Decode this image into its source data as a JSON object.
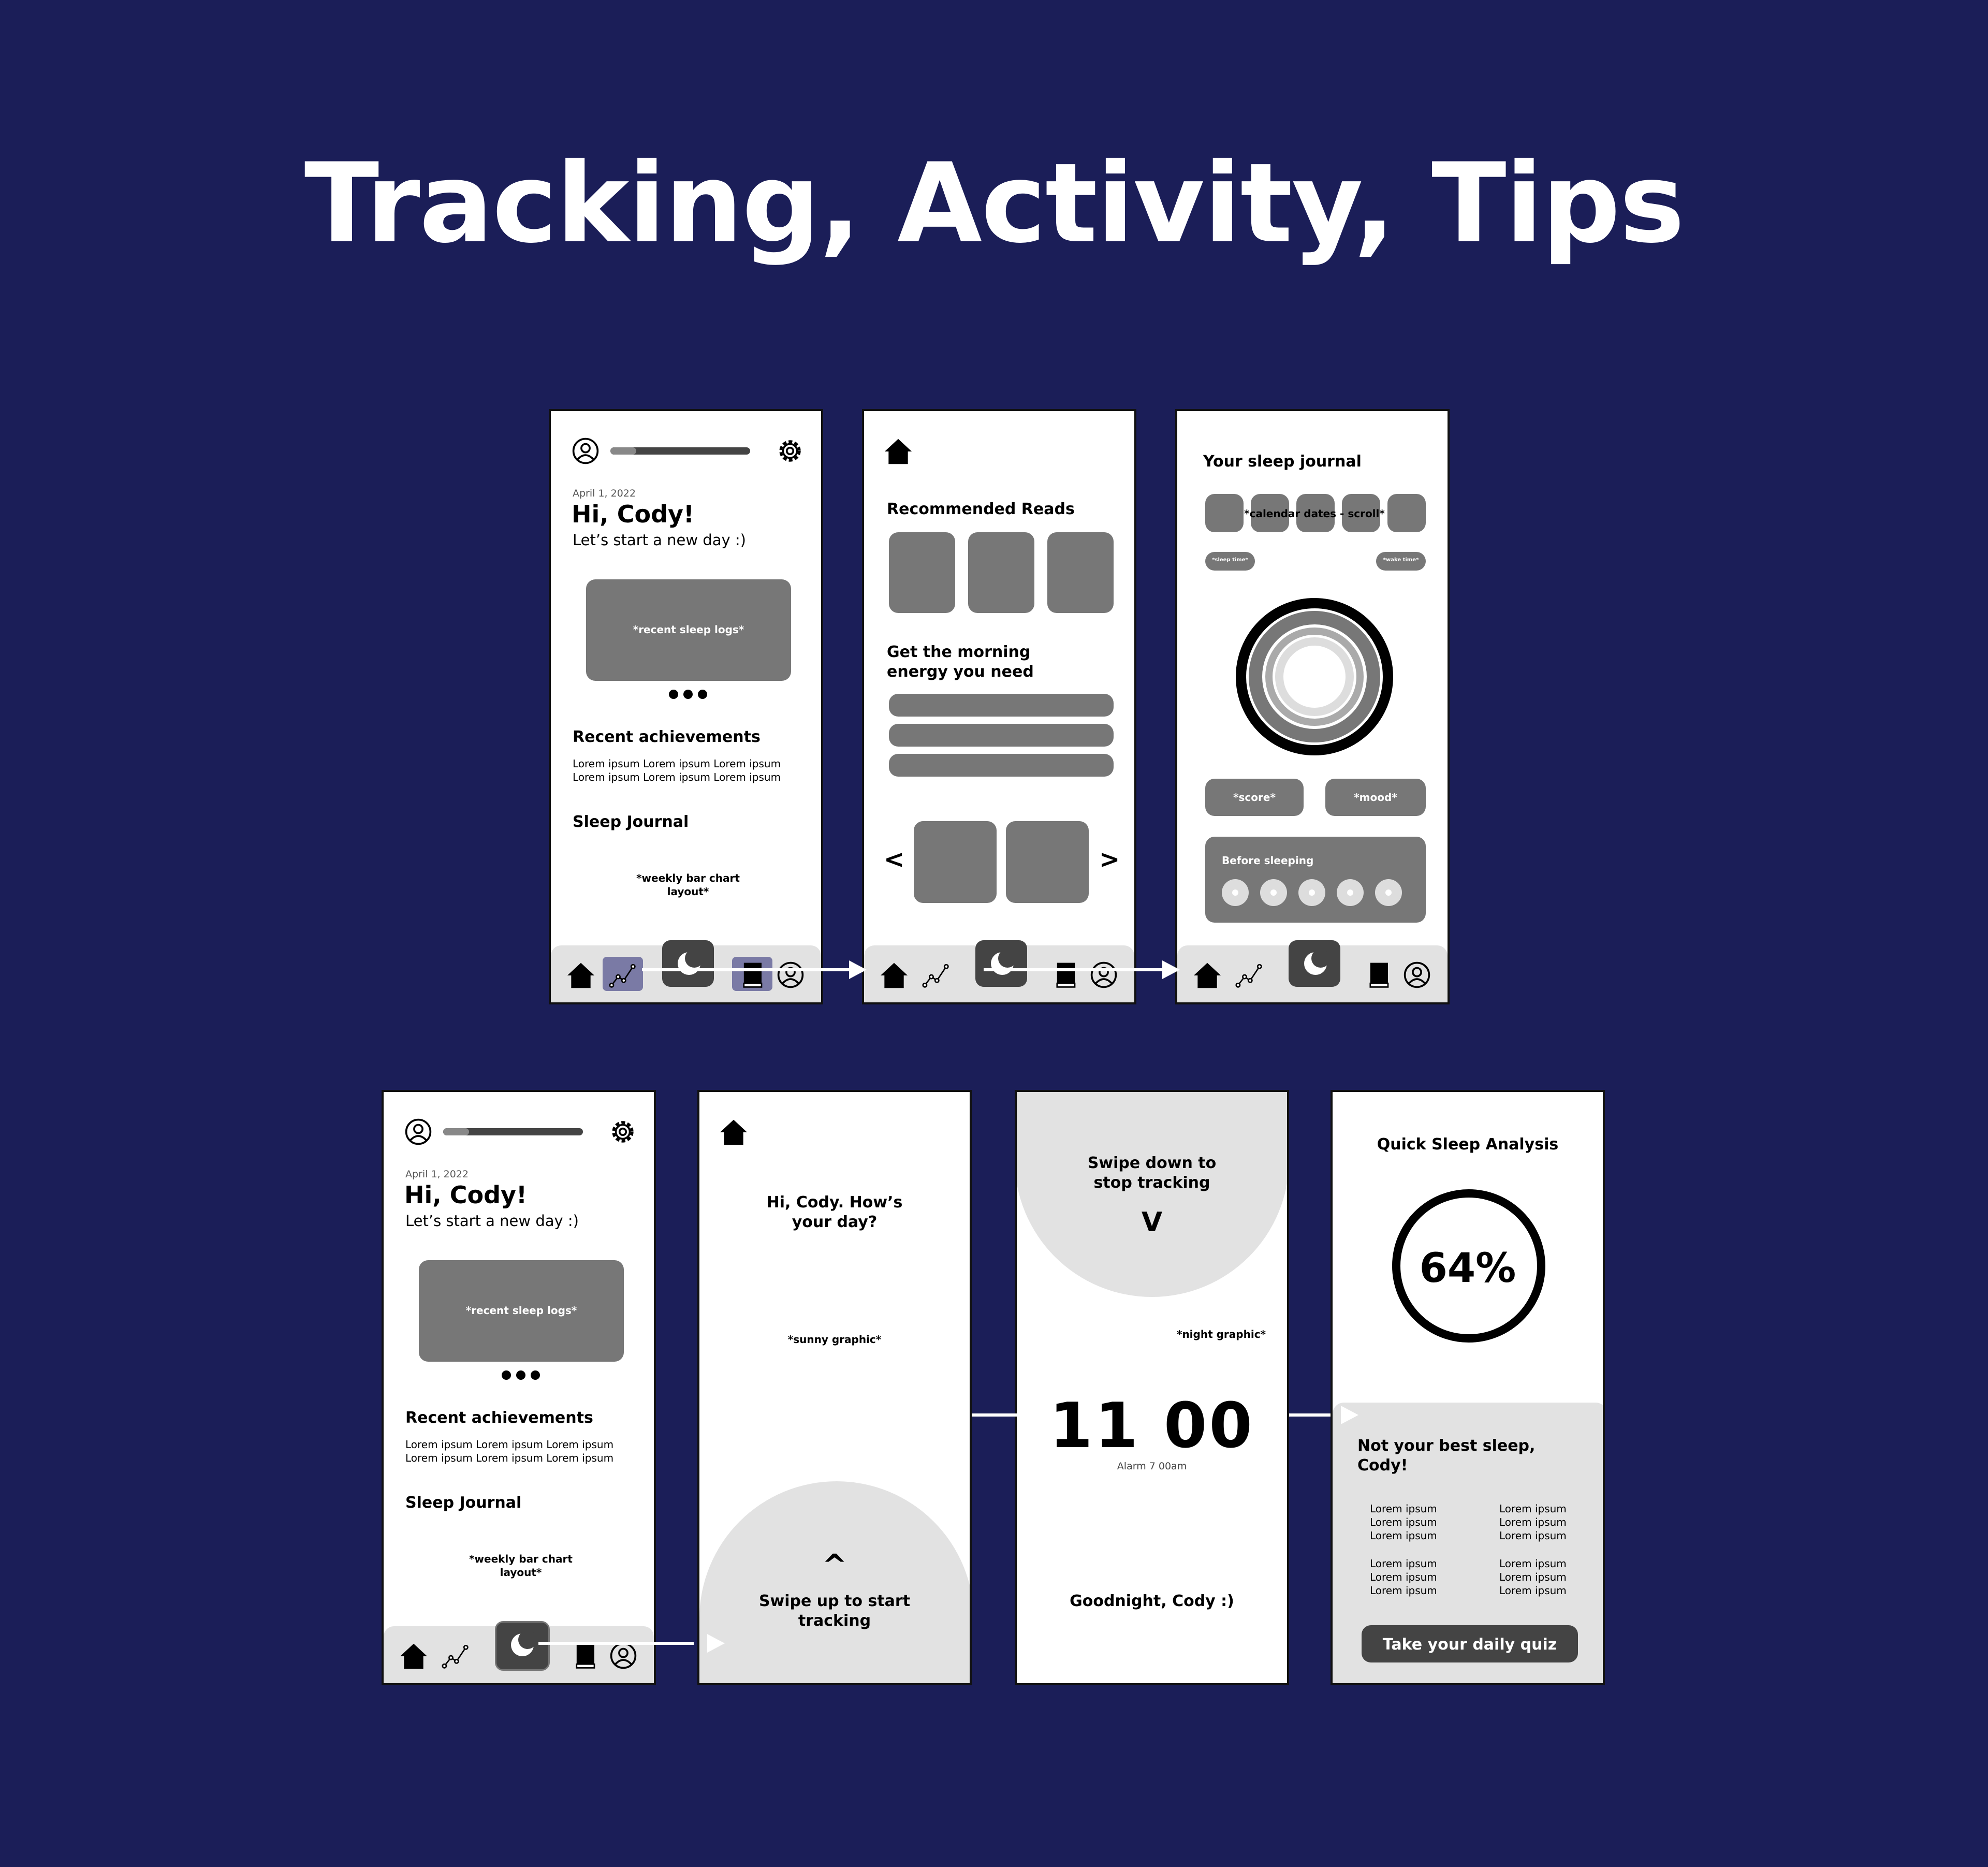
{
  "page_title": "Tracking, Activity, Tips",
  "colors": {
    "background": "#1b1e58",
    "gray_block": "#777777",
    "light_gray": "#e2e2e2",
    "dark": "#444444"
  },
  "home": {
    "date": "April 1, 2022",
    "greeting": "Hi, Cody!",
    "subtitle": "Let’s start a new day :)",
    "recent_logs": "*recent sleep logs*",
    "achievements_title": "Recent achievements",
    "lorem_line": "Lorem ipsum Lorem ipsum Lorem ipsum",
    "journal_title": "Sleep Journal",
    "chart_placeholder_1": "*weekly bar chart",
    "chart_placeholder_2": "layout*"
  },
  "tips": {
    "reads_title": "Recommended Reads",
    "energy_title_1": "Get the morning",
    "energy_title_2": "energy you need",
    "prev": "<",
    "next": ">"
  },
  "journal": {
    "title": "Your sleep journal",
    "calendar": "*calendar dates - scroll*",
    "sleep_time": "*sleep time*",
    "wake_time": "*wake time*",
    "score": "*score*",
    "mood": "*mood*",
    "before_sleeping": "Before sleeping"
  },
  "checkin": {
    "question_1": "Hi, Cody. How’s",
    "question_2": "your day?",
    "graphic": "*sunny graphic*",
    "caret": "^",
    "swipe_1": "Swipe up to start",
    "swipe_2": "tracking"
  },
  "tracking": {
    "swipe_1": "Swipe down to",
    "swipe_2": "stop tracking",
    "caret": "V",
    "graphic": "*night graphic*",
    "time": "11 00",
    "alarm": "Alarm 7 00am",
    "goodnight": "Goodnight, Cody :)"
  },
  "analysis": {
    "title": "Quick Sleep Analysis",
    "score_text": "64%",
    "score_value": 64,
    "message_1": "Not your best sleep,",
    "message_2": "Cody!",
    "lorem": "Lorem ipsum",
    "quiz_button": "Take your daily quiz"
  },
  "nav": {
    "icons": [
      "home-icon",
      "chart-icon",
      "moon-icon",
      "book-icon",
      "profile-icon"
    ]
  }
}
